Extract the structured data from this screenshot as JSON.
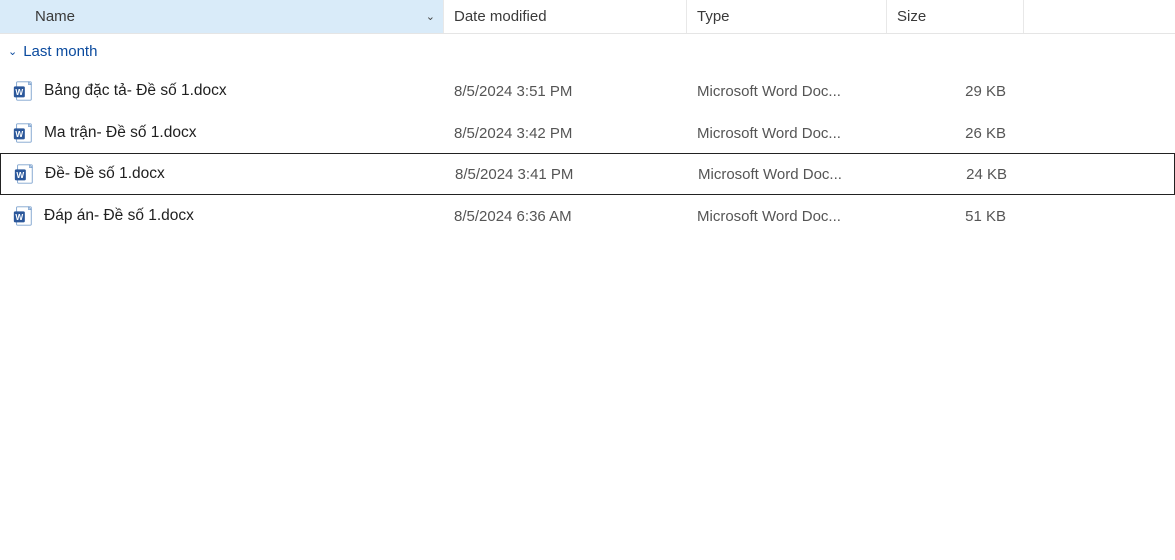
{
  "columns": {
    "name": "Name",
    "date": "Date modified",
    "type": "Type",
    "size": "Size"
  },
  "group": {
    "label": "Last month"
  },
  "files": [
    {
      "name": "Bảng đặc tả- Đề số 1.docx",
      "date": "8/5/2024 3:51 PM",
      "type": "Microsoft Word Doc...",
      "size": "29 KB",
      "selected": false
    },
    {
      "name": "Ma trận- Đề số 1.docx",
      "date": "8/5/2024 3:42 PM",
      "type": "Microsoft Word Doc...",
      "size": "26 KB",
      "selected": false
    },
    {
      "name": "Đề- Đề số 1.docx",
      "date": "8/5/2024 3:41 PM",
      "type": "Microsoft Word Doc...",
      "size": "24 KB",
      "selected": true
    },
    {
      "name": "Đáp án- Đề số 1.docx",
      "date": "8/5/2024 6:36 AM",
      "type": "Microsoft Word Doc...",
      "size": "51 KB",
      "selected": false
    }
  ]
}
